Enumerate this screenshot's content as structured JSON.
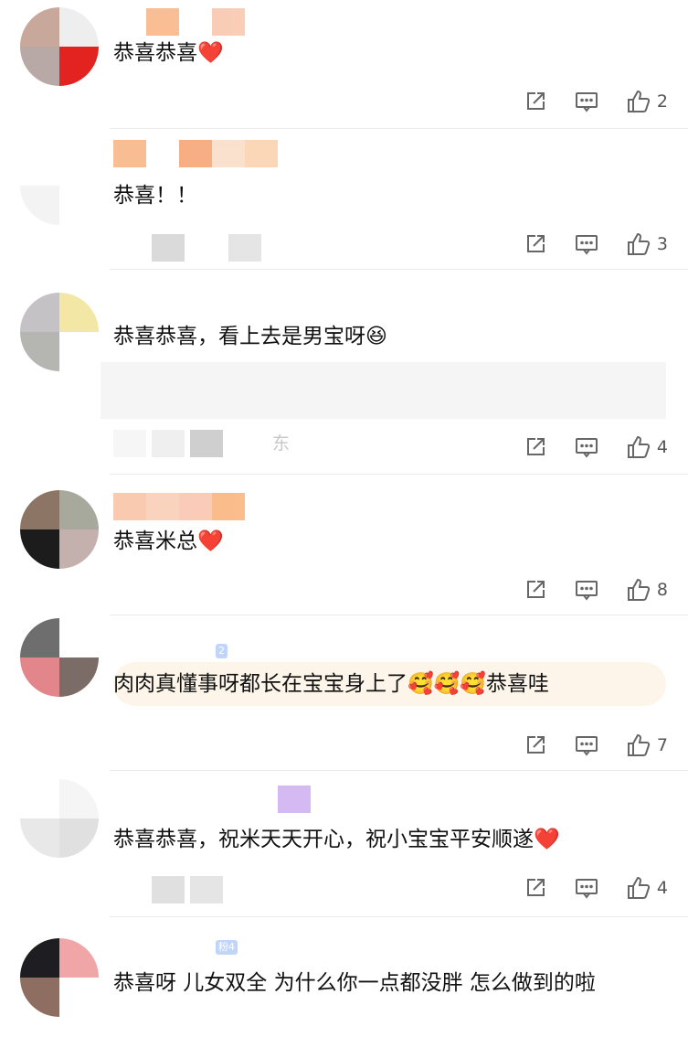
{
  "comments": [
    {
      "text": "恭喜恭喜❤️",
      "likes": "2"
    },
    {
      "text": "恭喜！！",
      "likes": "3"
    },
    {
      "text": "恭喜恭喜，看上去是男宝呀😆",
      "likes": "4",
      "meta_text": "东"
    },
    {
      "text": "恭喜米总❤️",
      "likes": "8"
    },
    {
      "text": "肉肉真懂事呀都长在宝宝身上了🥰🥰🥰恭喜哇",
      "likes": "7",
      "badge": "2"
    },
    {
      "text": "恭喜恭喜，祝米天天开心，祝小宝宝平安顺遂❤️",
      "likes": "4"
    },
    {
      "text": "恭喜呀 儿女双全 为什么你一点都没胖 怎么做到的啦",
      "badge": "粉4"
    }
  ],
  "icons": {
    "share": "share-icon",
    "reply": "comment-icon",
    "like": "thumbs-up-icon"
  },
  "colors": {
    "icon": "#666666",
    "heart": "#e8262b",
    "separator": "#ececec"
  }
}
